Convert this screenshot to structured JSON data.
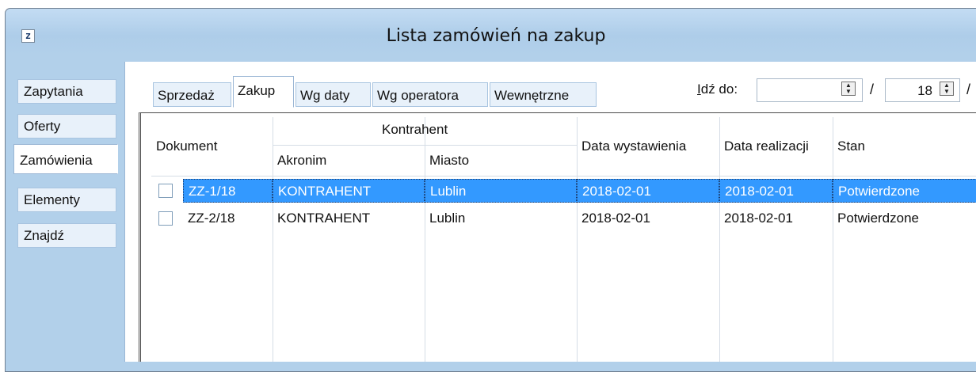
{
  "window": {
    "title": "Lista zamówień na zakup",
    "icon": "app-z-icon",
    "icon_glyph": "z"
  },
  "sidebar": {
    "items": [
      {
        "label": "Zapytania",
        "active": false
      },
      {
        "label": "Oferty",
        "active": false
      },
      {
        "label": "Zamówienia",
        "active": true
      },
      {
        "label": "Elementy",
        "active": false
      },
      {
        "label": "Znajdź",
        "active": false
      }
    ]
  },
  "tabs": [
    {
      "label": "Sprzedaż",
      "active": false
    },
    {
      "label": "Zakup",
      "active": true
    },
    {
      "label": "Wg daty",
      "active": false
    },
    {
      "label": "Wg operatora",
      "active": false
    },
    {
      "label": "Wewnętrzne",
      "active": false
    }
  ],
  "goto": {
    "label_underlined": "I",
    "label_rest": "dź do:",
    "value": "",
    "page_value": "18",
    "separator": "/"
  },
  "table": {
    "group_header": "Kontrahent",
    "columns": {
      "dokument": "Dokument",
      "akronim": "Akronim",
      "miasto": "Miasto",
      "data_wystawienia": "Data wystawienia",
      "data_realizacji": "Data realizacji",
      "stan": "Stan"
    },
    "rows": [
      {
        "dokument": "ZZ-1/18",
        "akronim": "KONTRAHENT",
        "miasto": "Lublin",
        "data_wystawienia": "2018-02-01",
        "data_realizacji": "2018-02-01",
        "stan": "Potwierdzone",
        "selected": true
      },
      {
        "dokument": "ZZ-2/18",
        "akronim": "KONTRAHENT",
        "miasto": "Lublin",
        "data_wystawienia": "2018-02-01",
        "data_realizacji": "2018-02-01",
        "stan": "Potwierdzone",
        "selected": false
      }
    ]
  },
  "colors": {
    "selection": "#3399ff",
    "frame": "#aecde9",
    "tab_border": "#a8c4e0"
  }
}
